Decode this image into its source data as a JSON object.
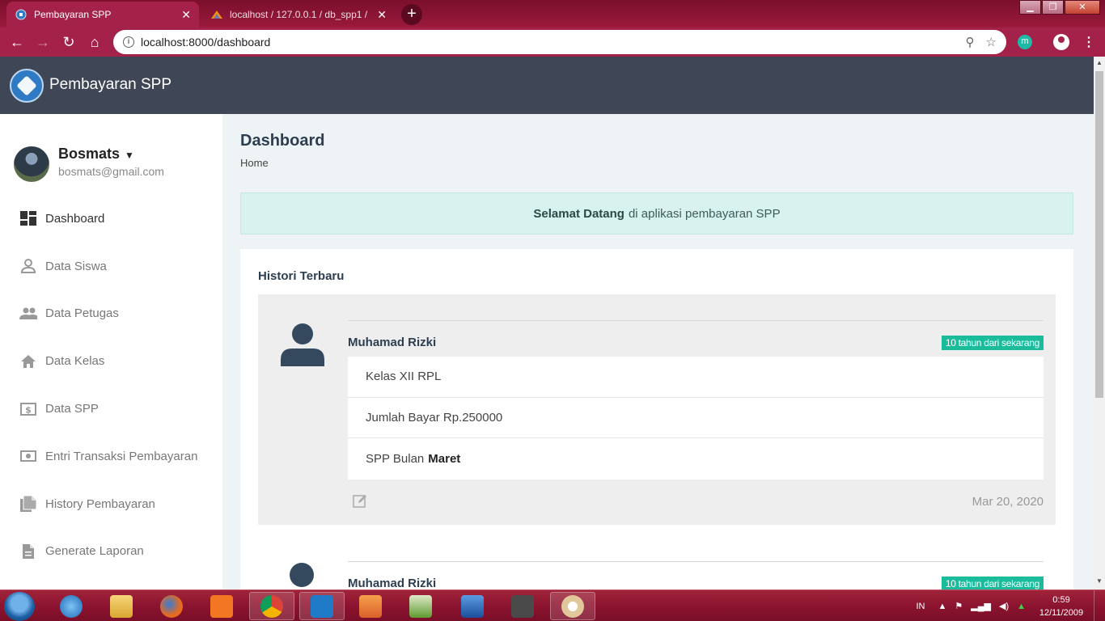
{
  "browser": {
    "tabs": [
      {
        "title": "Pembayaran SPP",
        "active": true
      },
      {
        "title": "localhost / 127.0.0.1 / db_spp1 / ",
        "active": false
      }
    ],
    "new_tab": "+",
    "url": "localhost:8000/dashboard",
    "extension_label": "m"
  },
  "app": {
    "brand": "Pembayaran SPP"
  },
  "user": {
    "name": "Bosmats",
    "email": "bosmats@gmail.com"
  },
  "sidebar": {
    "items": [
      {
        "label": "Dashboard",
        "icon": "dashboard-icon",
        "active": true
      },
      {
        "label": "Data Siswa",
        "icon": "person-icon"
      },
      {
        "label": "Data Petugas",
        "icon": "people-icon"
      },
      {
        "label": "Data Kelas",
        "icon": "home-icon"
      },
      {
        "label": "Data SPP",
        "icon": "dollar-icon"
      },
      {
        "label": "Entri Transaksi Pembayaran",
        "icon": "money-icon"
      },
      {
        "label": "History Pembayaran",
        "icon": "library-icon"
      },
      {
        "label": "Generate Laporan",
        "icon": "document-icon"
      }
    ]
  },
  "page": {
    "title": "Dashboard",
    "breadcrumb": "Home",
    "alert_bold": "Selamat Datang",
    "alert_text": "di aplikasi pembayaran SPP"
  },
  "history": {
    "title": "Histori Terbaru",
    "entries": [
      {
        "name": "Muhamad Rizki",
        "badge": "10 tahun dari sekarang",
        "kelas": "Kelas XII RPL",
        "jumlah": "Jumlah Bayar Rp.250000",
        "spp_prefix": "SPP Bulan",
        "spp_month": "Maret",
        "date": "Mar 20, 2020"
      },
      {
        "name": "Muhamad Rizki",
        "badge": "10 tahun dari sekarang"
      }
    ]
  },
  "taskbar": {
    "lang": "IN",
    "time": "0:59",
    "date": "12/11/2009"
  },
  "colors": {
    "header": "#3f4756",
    "browser_chrome": "#a4214a",
    "badge": "#1abc9c",
    "alert_bg": "#d8f2ee",
    "content_bg": "#eef4f6"
  }
}
